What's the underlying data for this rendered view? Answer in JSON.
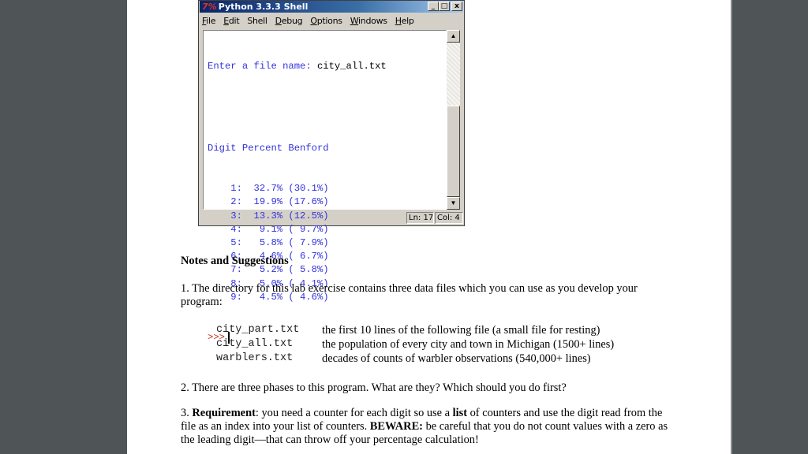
{
  "shell_window": {
    "title": "Python 3.3.3 Shell",
    "logo": "7%",
    "window_buttons": {
      "minimize": "_",
      "maximize": "□",
      "close": "x"
    },
    "menu": [
      {
        "label": "File",
        "underline": "F",
        "rest": "ile"
      },
      {
        "label": "Edit",
        "underline": "E",
        "rest": "dit"
      },
      {
        "label": "Shell",
        "underline": "",
        "rest": "Shell"
      },
      {
        "label": "Debug",
        "underline": "D",
        "rest": "ebug"
      },
      {
        "label": "Options",
        "underline": "O",
        "rest": "ptions"
      },
      {
        "label": "Windows",
        "underline": "W",
        "rest": "indows"
      },
      {
        "label": "Help",
        "underline": "H",
        "rest": "elp"
      }
    ],
    "input_prompt": "Enter a file name: ",
    "input_value": "city_all.txt",
    "table_header": "Digit Percent Benford",
    "rows": [
      {
        "digit": "1",
        "percent": "32.7%",
        "benford": "(30.1%)"
      },
      {
        "digit": "2",
        "percent": "19.9%",
        "benford": "(17.6%)"
      },
      {
        "digit": "3",
        "percent": "13.3%",
        "benford": "(12.5%)"
      },
      {
        "digit": "4",
        "percent": "9.1%",
        "benford": "( 9.7%)"
      },
      {
        "digit": "5",
        "percent": "5.8%",
        "benford": "( 7.9%)"
      },
      {
        "digit": "6",
        "percent": "4.6%",
        "benford": "( 6.7%)"
      },
      {
        "digit": "7",
        "percent": "5.2%",
        "benford": "( 5.8%)"
      },
      {
        "digit": "8",
        "percent": "5.0%",
        "benford": "( 4.1%)"
      },
      {
        "digit": "9",
        "percent": "4.5%",
        "benford": "( 4.6%)"
      }
    ],
    "prompt": ">>>",
    "status": {
      "line": "Ln: 17",
      "col": "Col: 4"
    },
    "scroll_position": 0.45
  },
  "document": {
    "heading": "Notes and Suggestions",
    "item1": "1.  The directory for this lab exercise contains three data files which you can use as you develop your program:",
    "files": [
      {
        "name": "city_part.txt",
        "description": "the first 10 lines of the following file (a small file for resting)"
      },
      {
        "name": "city_all.txt",
        "description": "the population of every city and town in Michigan (1500+ lines)"
      },
      {
        "name": "warblers.txt",
        "description": "decades of counts of warbler observations (540,000+ lines)"
      }
    ],
    "item2": "2.  There are three phases to this program.  What are they?  Which should you do first?",
    "item3": {
      "number": "3.  ",
      "requirement_label": "Requirement",
      "part1": ": you need a counter for each digit so use a ",
      "list_word": "list",
      "part2": " of counters and use the digit read from the file as an index into your list of counters. ",
      "beware_label": "BEWARE:",
      "part3": " be careful that you do not count values with a zero as the leading digit—that can throw off your percentage calculation!"
    }
  }
}
